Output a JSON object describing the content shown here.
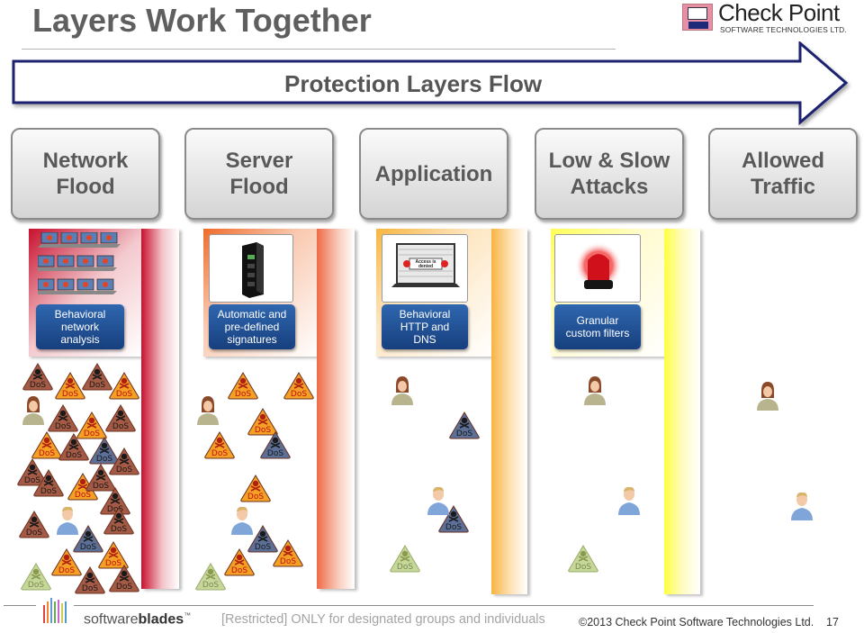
{
  "header": {
    "title": "Layers Work Together",
    "logo": {
      "name": "Check Point",
      "subtitle": "SOFTWARE TECHNOLOGIES LTD.",
      "icon": "monitor-logo-icon"
    }
  },
  "flow": {
    "label": "Protection Layers Flow",
    "icon": "right-arrow-icon"
  },
  "layers": [
    {
      "label": "Network\nFlood"
    },
    {
      "label": "Server\nFlood"
    },
    {
      "label": "Application"
    },
    {
      "label": "Low & Slow\nAttacks"
    },
    {
      "label": "Allowed\nTraffic"
    }
  ],
  "protections": [
    {
      "badge": "Behavioral\nnetwork\nanalysis",
      "image": "laptop-grid-icon",
      "color": "#c8102e"
    },
    {
      "badge": "Automatic and\npre-defined\nsignatures",
      "image": "server-rack-icon",
      "color": "#f06a2a"
    },
    {
      "badge": "Behavioral\nHTTP and\nDNS",
      "image": "access-denied-laptop-icon",
      "color": "#f7b733"
    },
    {
      "badge": "Granular\ncustom  filters",
      "image": "red-alarm-light-icon",
      "color": "#ffff33"
    }
  ],
  "traffic": {
    "dos_label": "DoS",
    "dos_colors": {
      "brown": "#a45a45",
      "orange": "#f4a024",
      "blue": "#5b6f97",
      "green": "#c6d79a"
    }
  },
  "footer": {
    "brand": {
      "light": "software",
      "bold": "blades",
      "tm": "™"
    },
    "restriction": "[Restricted] ONLY for designated groups and individuals",
    "copyright": "©2013 Check Point Software Technologies Ltd.",
    "page_number": "17"
  }
}
